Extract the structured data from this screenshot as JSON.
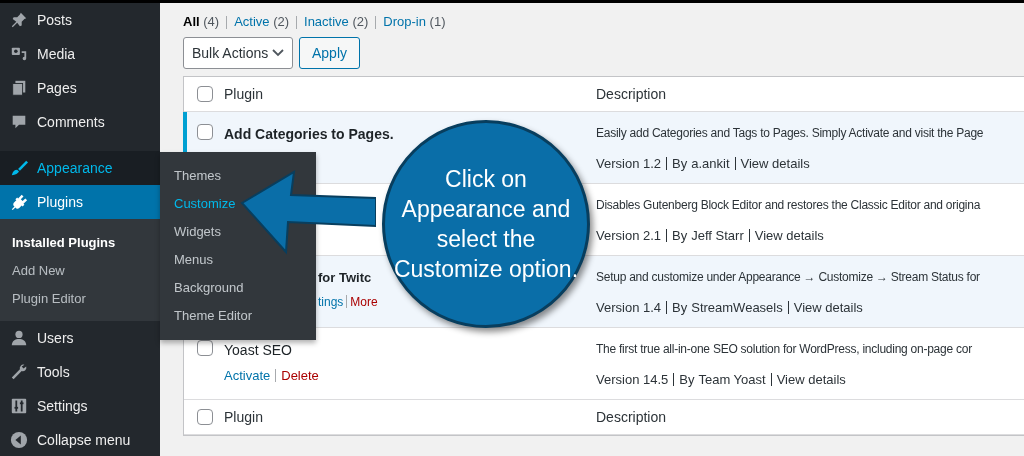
{
  "sidebar": {
    "groups": [
      {
        "items": [
          {
            "label": "Posts",
            "selected": false,
            "open": false
          },
          {
            "label": "Media",
            "selected": false,
            "open": false
          },
          {
            "label": "Pages",
            "selected": false,
            "open": false
          },
          {
            "label": "Comments",
            "selected": false,
            "open": false
          }
        ]
      },
      {
        "items": [
          {
            "label": "Appearance",
            "selected": false,
            "open": true,
            "flyout": [
              {
                "label": "Themes",
                "selected": false
              },
              {
                "label": "Customize",
                "selected": true
              },
              {
                "label": "Widgets",
                "selected": false
              },
              {
                "label": "Menus",
                "selected": false
              },
              {
                "label": "Background",
                "selected": false
              },
              {
                "label": "Theme Editor",
                "selected": false
              }
            ]
          },
          {
            "label": "Plugins",
            "selected": true,
            "open": false,
            "submenu": [
              {
                "label": "Installed Plugins",
                "selected": true
              },
              {
                "label": "Add New",
                "selected": false
              },
              {
                "label": "Plugin Editor",
                "selected": false
              }
            ]
          },
          {
            "label": "Users",
            "selected": false,
            "open": false
          },
          {
            "label": "Tools",
            "selected": false,
            "open": false
          },
          {
            "label": "Settings",
            "selected": false,
            "open": false
          }
        ]
      }
    ],
    "collapse": "Collapse menu"
  },
  "filters": [
    {
      "label": "All",
      "count": "(4)",
      "selected": true
    },
    {
      "label": "Active",
      "count": "(2)",
      "selected": false
    },
    {
      "label": "Inactive",
      "count": "(2)",
      "selected": false
    },
    {
      "label": "Drop-in",
      "count": "(1)",
      "selected": false
    }
  ],
  "bulk_actions": {
    "label": "Bulk Actions",
    "button": "Apply"
  },
  "table": {
    "columns": [
      "Plugin",
      "Description"
    ],
    "header_checked": false,
    "rows": [
      {
        "active": true,
        "checkbox": true,
        "checked": false,
        "partly_covered": false,
        "name": "Add Categories to Pages.",
        "actions": [],
        "description": "Easily add Categories and Tags to Pages. Simply Activate and visit the Page",
        "version": "Version 1.2",
        "by": "By",
        "author": "a.ankit",
        "details": "View details"
      },
      {
        "active": false,
        "actions": [],
        "description": "Disables Gutenberg Block Editor and restores the Classic Editor and origina",
        "version": "Version 2.1",
        "by": "By",
        "author": "Jeff Starr",
        "details": "View details"
      },
      {
        "active": true,
        "checkbox": false,
        "partly_covered": true,
        "name": "for Twitc",
        "actions": [
          {
            "label": "tings",
            "kind": "link"
          },
          {
            "label": "More",
            "kind": "danger"
          }
        ],
        "description": "Setup and customize under Appearance → Customize → Stream Status for",
        "version": "Version 1.4",
        "by": "By",
        "author": "StreamWeasels",
        "details": "View details"
      },
      {
        "active": false,
        "checkbox": true,
        "checked": false,
        "partly_covered": false,
        "name": "Yoast SEO",
        "actions": [
          {
            "label": "Activate",
            "kind": "link"
          },
          {
            "label": "Delete",
            "kind": "danger"
          }
        ],
        "description": "The first true all-in-one SEO solution for WordPress, including on-page cor",
        "version": "Version 14.5",
        "by": "By",
        "author": "Team Yoast",
        "details": "View details"
      }
    ],
    "footer_columns": [
      "Plugin",
      "Description"
    ],
    "footer_checked": false
  },
  "callout": {
    "text": "Click on Appearance and select the Customize option."
  }
}
